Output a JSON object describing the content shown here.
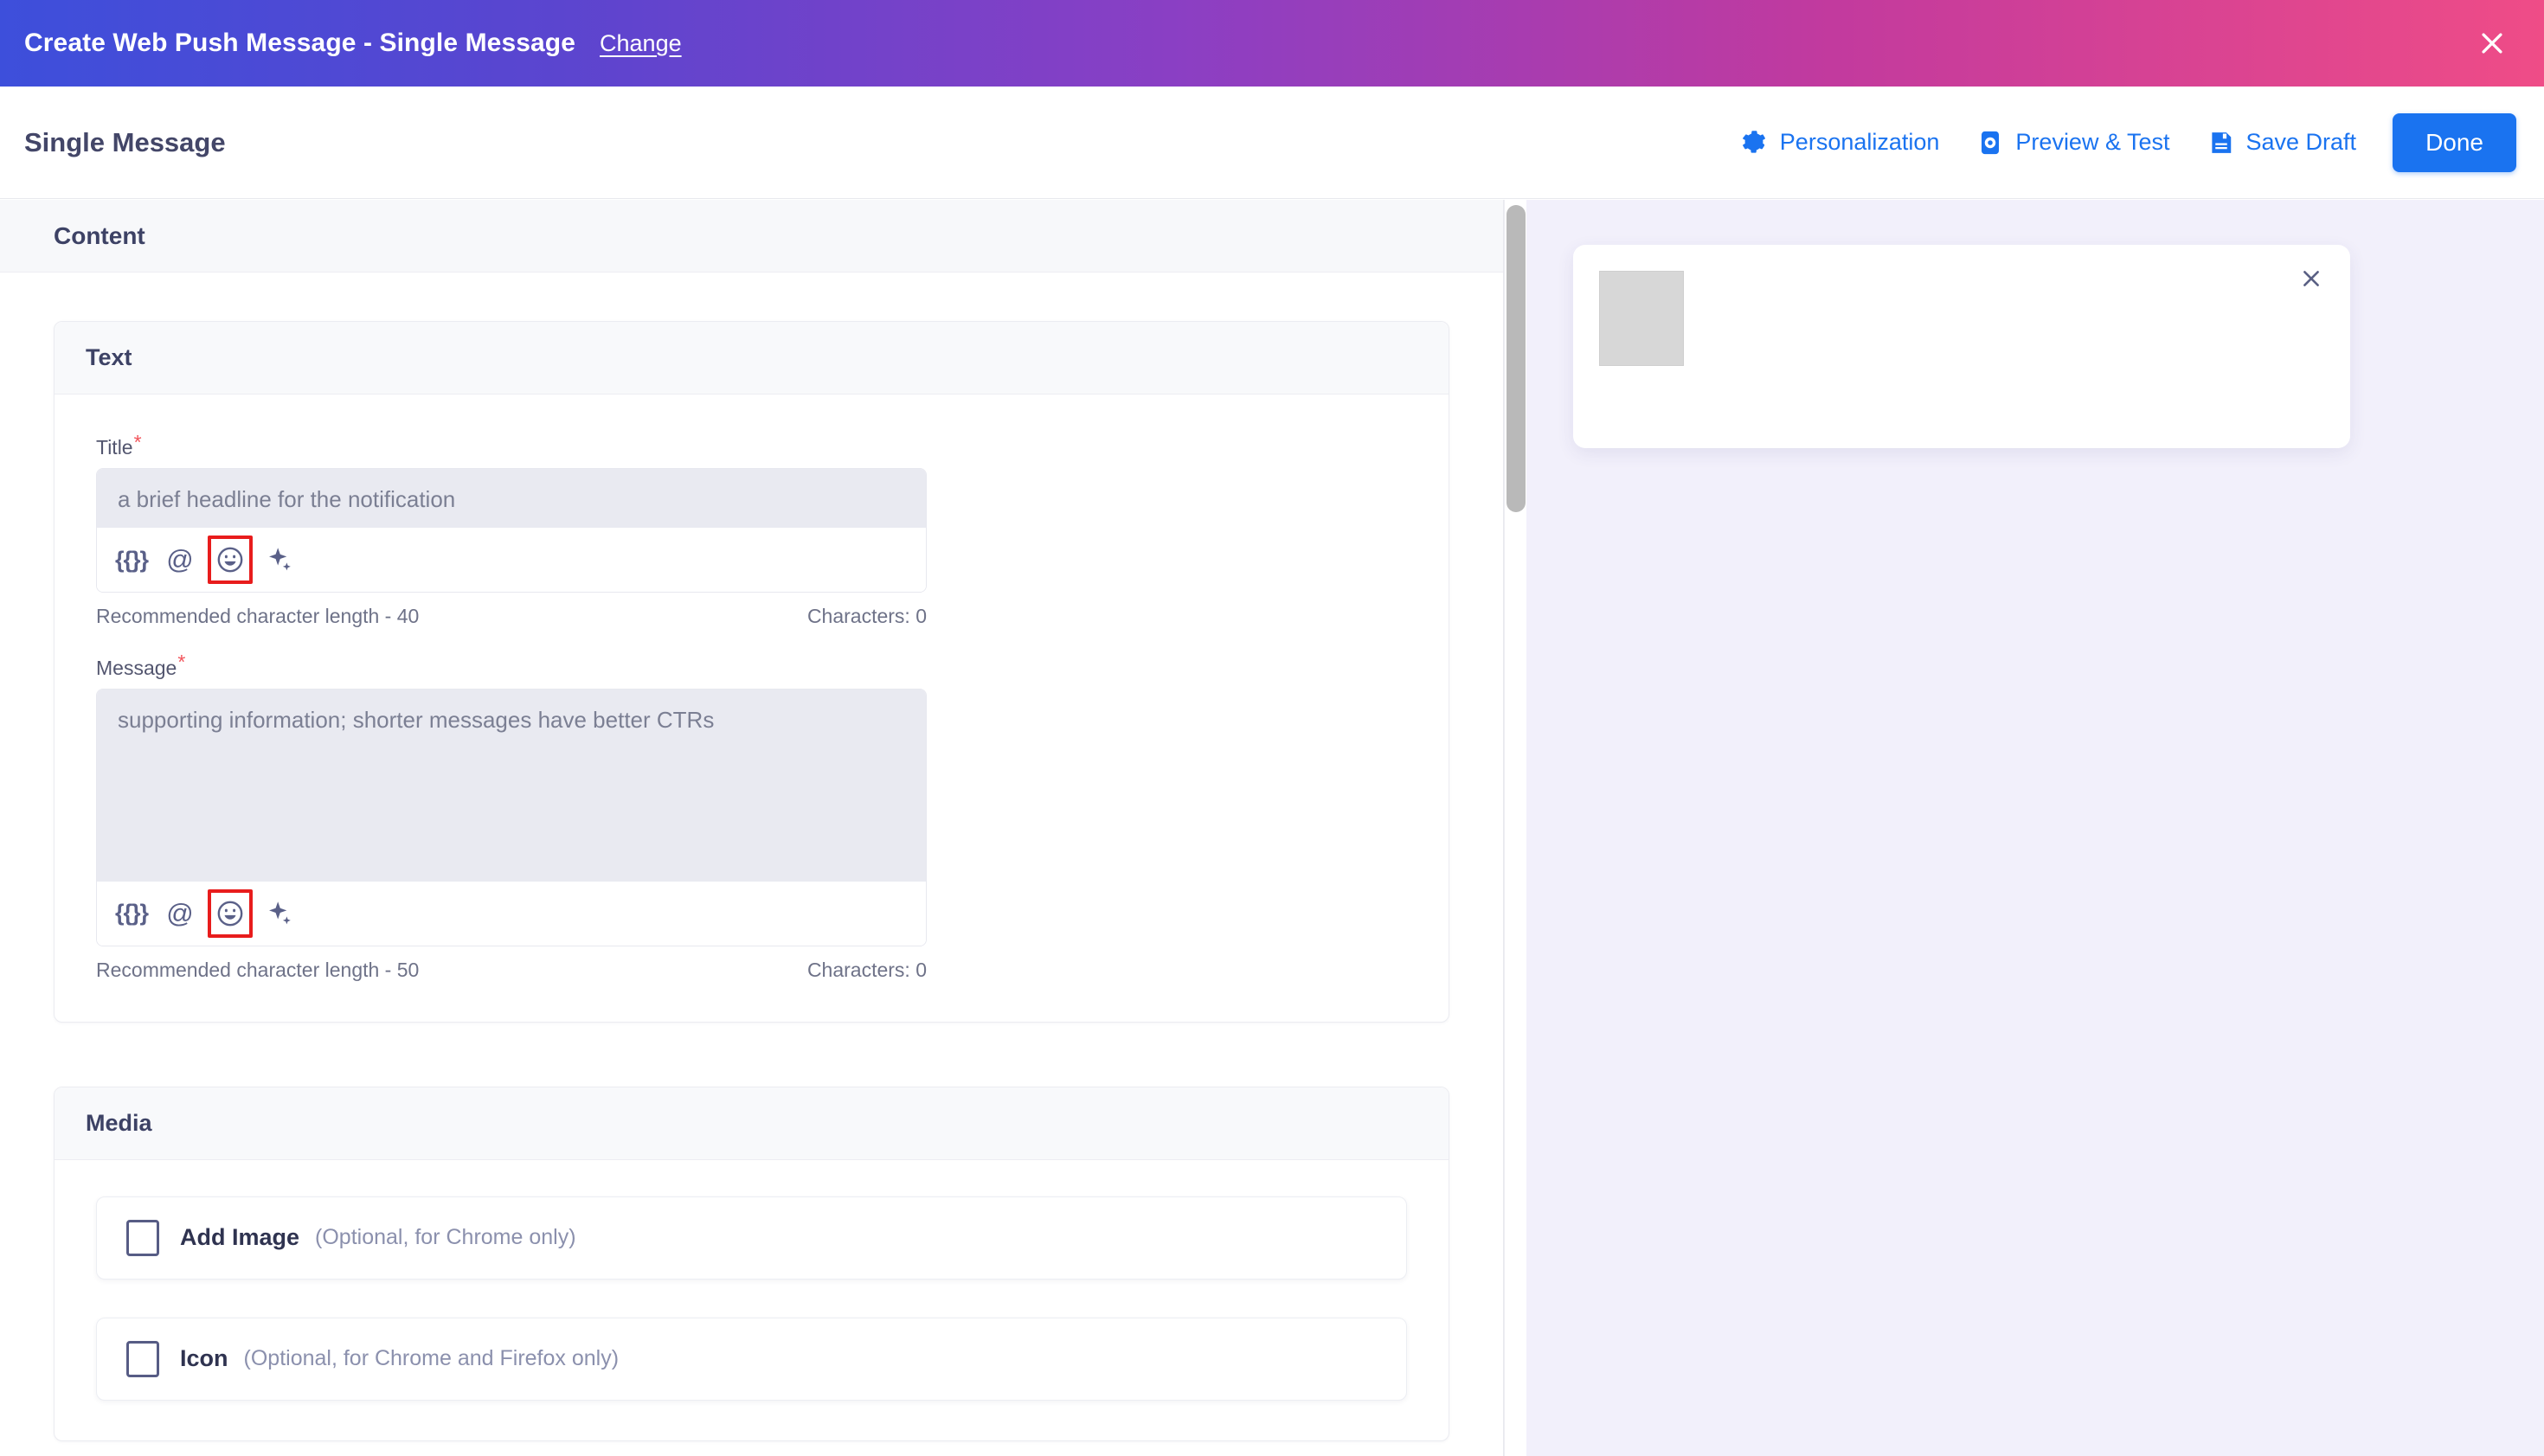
{
  "titlebar": {
    "title": "Create Web Push Message - Single Message",
    "change_label": "Change",
    "close_icon": "close-icon",
    "gradient_from": "#3d4fdb",
    "gradient_to": "#ef4c87"
  },
  "subbar": {
    "title": "Single Message",
    "actions": [
      {
        "label": "Personalization",
        "icon": "gear-icon"
      },
      {
        "label": "Preview & Test",
        "icon": "device-preview-icon"
      },
      {
        "label": "Save Draft",
        "icon": "floppy-disk-icon"
      }
    ],
    "done_label": "Done",
    "accent_color": "#1a73f0"
  },
  "content": {
    "header_label": "Content",
    "text_card": {
      "header_label": "Text",
      "title_field": {
        "label": "Title",
        "required_marker": "*",
        "value": "",
        "placeholder": "a brief headline for the notification",
        "recommended_text": "Recommended character length - 40",
        "characters_text": "Characters: 0",
        "toolbar": [
          {
            "name": "liquid-tag-icon",
            "glyph": "{{}}"
          },
          {
            "name": "mention-icon",
            "glyph": "@"
          },
          {
            "name": "emoji-icon",
            "glyph": "smiley",
            "highlighted": true
          },
          {
            "name": "ai-sparkle-icon",
            "glyph": "sparkle"
          }
        ]
      },
      "message_field": {
        "label": "Message",
        "required_marker": "*",
        "value": "",
        "placeholder": "supporting information; shorter messages have better CTRs",
        "recommended_text": "Recommended character length - 50",
        "characters_text": "Characters: 0",
        "toolbar": [
          {
            "name": "liquid-tag-icon",
            "glyph": "{{}}"
          },
          {
            "name": "mention-icon",
            "glyph": "@"
          },
          {
            "name": "emoji-icon",
            "glyph": "smiley",
            "highlighted": true
          },
          {
            "name": "ai-sparkle-icon",
            "glyph": "sparkle"
          }
        ]
      }
    },
    "media_card": {
      "header_label": "Media",
      "rows": [
        {
          "label": "Add Image",
          "hint": "(Optional, for Chrome only)",
          "checked": false
        },
        {
          "label": "Icon",
          "hint": "(Optional, for Chrome and Firefox only)",
          "checked": false
        }
      ]
    }
  },
  "preview": {
    "background_color": "#f2f0fb",
    "card": {
      "thumbnail_placeholder": "image-placeholder",
      "close_icon": "close-icon"
    }
  },
  "scrollbar": {
    "name": "content-scrollbar",
    "thumb_color": "#b9b9b9"
  },
  "highlight_color": "#e81c1c"
}
